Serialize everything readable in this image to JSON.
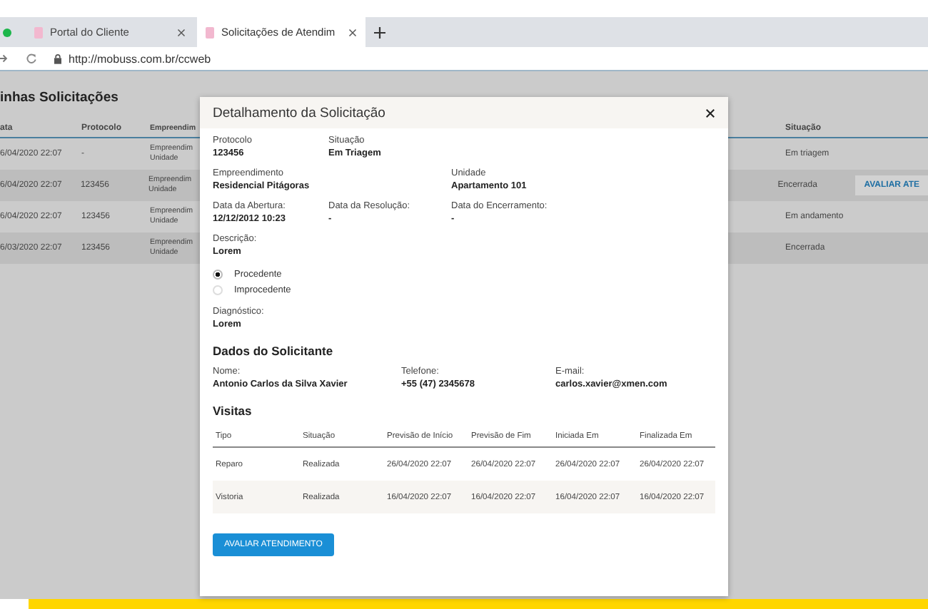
{
  "browser": {
    "tabs": [
      {
        "title": "Portal do Cliente",
        "selected": false
      },
      {
        "title": "Solicitações de Atendim",
        "selected": true
      }
    ],
    "url": "http://mobuss.com.br/ccweb"
  },
  "page": {
    "title": "inhas Solicitações",
    "columns": [
      "ata",
      "Protocolo",
      "Empreendim",
      "Situação"
    ],
    "rows": [
      {
        "date": "6/04/2020 22:07",
        "protocolo": "-",
        "empreendimento": "Empreendim",
        "unidade": "Unidade",
        "situacao": "Em triagem"
      },
      {
        "date": "6/04/2020 22:07",
        "protocolo": "123456",
        "empreendimento": "Empreendim",
        "unidade": "Unidade",
        "situacao": "Encerrada",
        "action": "AVALIAR ATE"
      },
      {
        "date": "6/04/2020 22:07",
        "protocolo": "123456",
        "empreendimento": "Empreendim",
        "unidade": "Unidade",
        "situacao": "Em andamento"
      },
      {
        "date": "6/03/2020 22:07",
        "protocolo": "123456",
        "empreendimento": "Empreendim",
        "unidade": "Unidade",
        "situacao": "Encerrada"
      }
    ]
  },
  "modal": {
    "title": "Detalhamento da Solicitação",
    "fields": [
      {
        "label": "Protocolo",
        "value": "123456",
        "kind": "normal"
      },
      {
        "label": "Situação",
        "value": "Em Triagem",
        "kind": "wide"
      },
      {
        "label": "Empreendimento",
        "value": "Residencial Pitágoras",
        "kind": "wide"
      },
      {
        "label": "Unidade",
        "value": "Apartamento 101",
        "kind": "normal"
      },
      {
        "label": "Data da Abertura:",
        "value": "12/12/2012 10:23",
        "kind": "normal"
      },
      {
        "label": "Data da Resolução:",
        "value": "-",
        "kind": "normal"
      },
      {
        "label": "Data do Encerramento:",
        "value": "-",
        "kind": "normal"
      },
      {
        "label": "Descrição:",
        "value": "Lorem",
        "kind": "full"
      }
    ],
    "options": [
      {
        "label": "Procedente",
        "selected": true
      },
      {
        "label": "Improcedente",
        "selected": false
      }
    ],
    "diagnosis": {
      "label": "Diagnóstico:",
      "value": "Lorem"
    },
    "requester": {
      "heading": "Dados do Solicitante",
      "fields": [
        {
          "label": "Nome:",
          "value": "Antonio Carlos da Silva Xavier"
        },
        {
          "label": "Telefone:",
          "value": "+55 (47) 2345678"
        },
        {
          "label": "E-mail:",
          "value": "carlos.xavier@xmen.com"
        }
      ]
    },
    "visits": {
      "heading": "Visitas",
      "columns": [
        "Tipo",
        "Situação",
        "Previsão de Início",
        "Previsão de Fim",
        "Iniciada Em",
        "Finalizada Em"
      ],
      "rows": [
        [
          "Reparo",
          "Realizada",
          "26/04/2020 22:07",
          "26/04/2020 22:07",
          "26/04/2020 22:07",
          "26/04/2020 22:07"
        ],
        [
          "Vistoria",
          "Realizada",
          "16/04/2020 22:07",
          "16/04/2020 22:07",
          "16/04/2020 22:07",
          "16/04/2020 22:07"
        ]
      ]
    },
    "button": "AVALIAR ATENDIMENTO"
  }
}
